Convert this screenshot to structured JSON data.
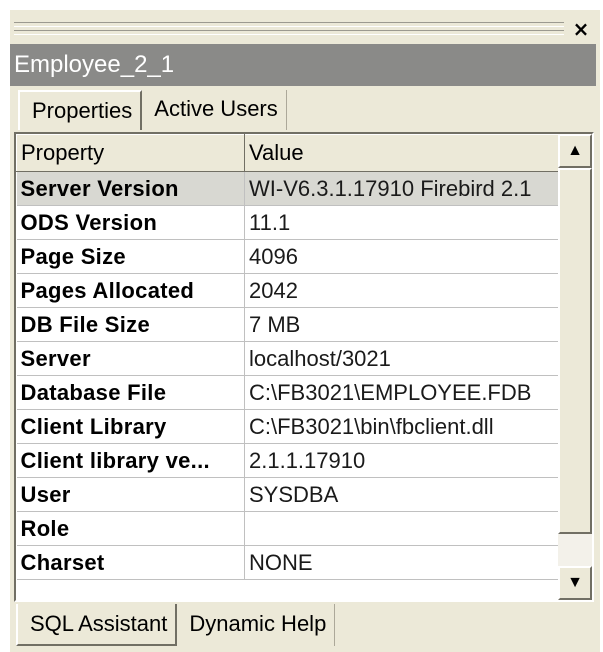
{
  "panel": {
    "close_glyph": "×",
    "title": "Employee_2_1"
  },
  "tabs_top": [
    {
      "label": "Properties",
      "active": true
    },
    {
      "label": "Active Users",
      "active": false
    }
  ],
  "grid": {
    "headers": {
      "property": "Property",
      "value": "Value"
    },
    "rows": [
      {
        "property": "Server Version",
        "value": "WI-V6.3.1.17910 Firebird 2.1",
        "selected": true
      },
      {
        "property": "ODS Version",
        "value": "11.1"
      },
      {
        "property": "Page Size",
        "value": "4096"
      },
      {
        "property": "Pages Allocated",
        "value": "2042"
      },
      {
        "property": "DB File Size",
        "value": "7 MB"
      },
      {
        "property": "Server",
        "value": "localhost/3021"
      },
      {
        "property": "Database File",
        "value": "C:\\FB3021\\EMPLOYEE.FDB"
      },
      {
        "property": "Client Library",
        "value": "C:\\FB3021\\bin\\fbclient.dll"
      },
      {
        "property": "Client library ve...",
        "value": "2.1.1.17910"
      },
      {
        "property": "User",
        "value": "SYSDBA"
      },
      {
        "property": "Role",
        "value": ""
      },
      {
        "property": "Charset",
        "value": "NONE"
      }
    ],
    "scroll_up_glyph": "▲",
    "scroll_down_glyph": "▼"
  },
  "tabs_bottom": [
    {
      "label": "SQL Assistant",
      "active": true
    },
    {
      "label": "Dynamic Help",
      "active": false
    }
  ],
  "colors": {
    "panel_bg": "#ece9d8",
    "titlebar_bg": "#8a8a88",
    "selected_row": "#d8d8d2"
  }
}
